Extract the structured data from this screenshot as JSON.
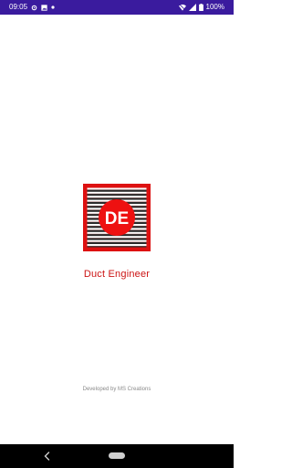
{
  "status_bar": {
    "time": "09:05",
    "battery": "100%",
    "background": "#3a1b9e"
  },
  "app": {
    "name": "Duct Engineer",
    "logo_letters": "DE",
    "brand_color": "#cc1414"
  },
  "footer": {
    "credit": "Developed by MS Creations"
  },
  "icons": {
    "status_left": [
      "settings-gear-icon",
      "image-icon",
      "notification-dot-icon"
    ],
    "status_right": [
      "wifi-icon",
      "cellular-signal-icon",
      "battery-icon"
    ],
    "navigation": [
      "back-icon",
      "home-pill-icon"
    ]
  }
}
